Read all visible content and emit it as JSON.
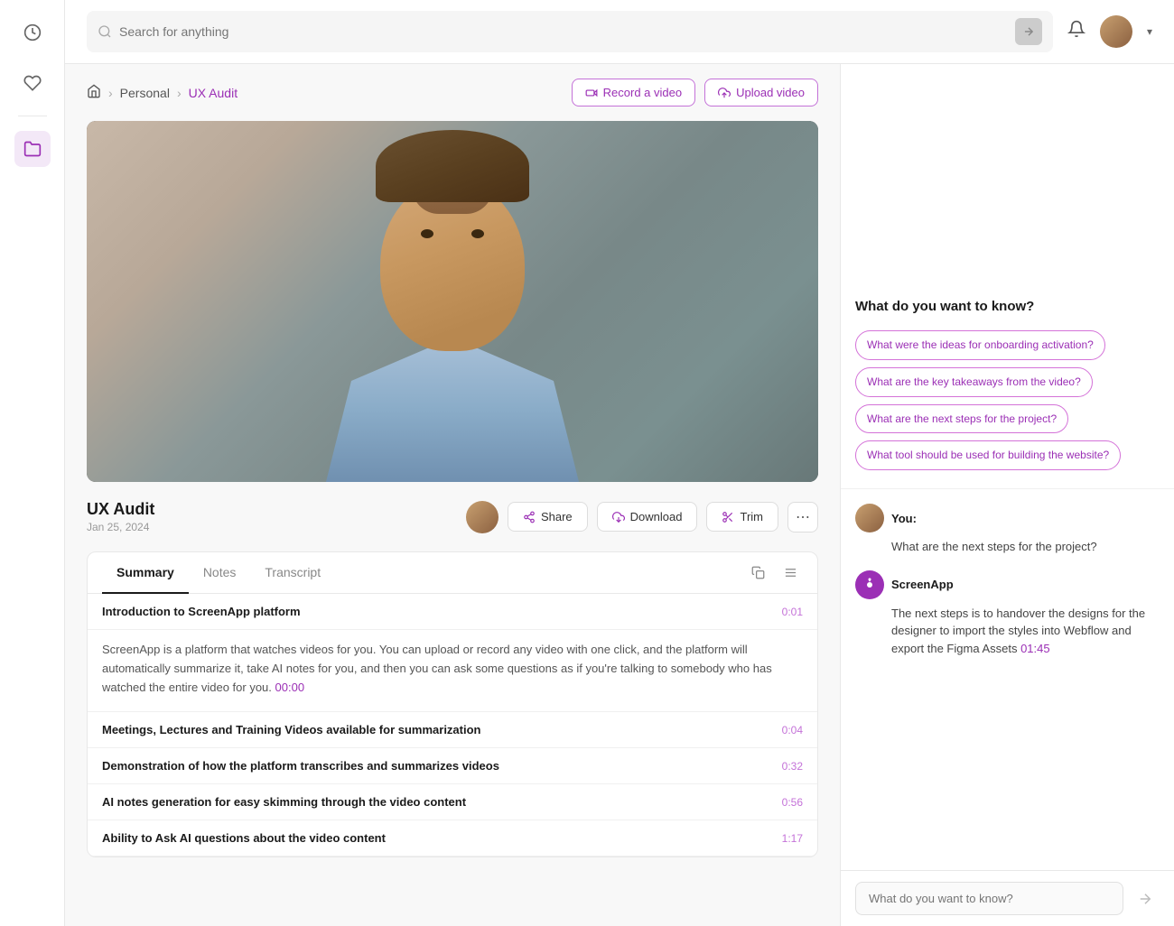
{
  "topbar": {
    "search_placeholder": "Search for anything",
    "record_label": "Record a video",
    "upload_label": "Upload video"
  },
  "breadcrumb": {
    "home_icon": "🏠",
    "personal": "Personal",
    "current": "UX Audit"
  },
  "video": {
    "title": "UX Audit",
    "date": "Jan 25, 2024",
    "share_label": "Share",
    "download_label": "Download",
    "trim_label": "Trim"
  },
  "tabs": {
    "items": [
      {
        "id": "summary",
        "label": "Summary",
        "active": true
      },
      {
        "id": "notes",
        "label": "Notes",
        "active": false
      },
      {
        "id": "transcript",
        "label": "Transcript",
        "active": false
      }
    ]
  },
  "summary": {
    "sections": [
      {
        "title": "Introduction to ScreenApp platform",
        "timestamp": "0:01",
        "body": "ScreenApp is a platform that watches videos for you. You can upload or record any video with one click, and the platform will automatically summarize it, take AI notes for you, and then you can ask some questions as if you're talking to somebody who has watched the entire video for you.",
        "timestamp_link": "00:00"
      },
      {
        "title": "Meetings, Lectures and Training Videos available for summarization",
        "timestamp": "0:04",
        "body": null
      },
      {
        "title": "Demonstration of how the platform transcribes and summarizes videos",
        "timestamp": "0:32",
        "body": null
      },
      {
        "title": "AI notes generation for easy skimming through the video content",
        "timestamp": "0:56",
        "body": null
      },
      {
        "title": "Ability to Ask AI questions about the video content",
        "timestamp": "1:17",
        "body": null
      }
    ]
  },
  "ai_panel": {
    "title": "What do you want to know?",
    "suggestions": [
      "What were the ideas for onboarding activation?",
      "What are the key takeaways from the video?",
      "What are the next steps for the project?",
      "What tool should be used for building the website?"
    ],
    "chat": [
      {
        "sender": "You",
        "type": "user",
        "text": "What are the next steps for the project?"
      },
      {
        "sender": "ScreenApp",
        "type": "ai",
        "text": "The next steps is to handover the designs for the designer to import the styles into Webflow and export the Figma Assets",
        "timestamp": "01:45"
      }
    ],
    "input_placeholder": "What do you want to know?"
  }
}
